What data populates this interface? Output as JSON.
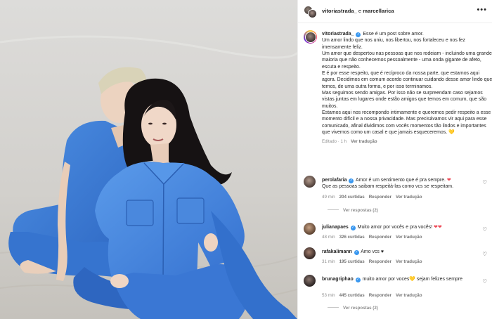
{
  "header": {
    "author": "vitoriastrada_",
    "connector": " e ",
    "coauthor": "marcellarica",
    "more_icon": "more-horizontal-icon"
  },
  "caption": {
    "username": "vitoriastrada_",
    "text": "Esse é um post sobre amor.\nUm amor lindo que nos uniu, nos libertou, nos fortaleceu e nos fez imensamente feliz.\nUm amor que despertou nas pessoas que nos rodeiam - incluindo uma grande maioria que não conhecemos pessoalmente - uma onda gigante de afeto, escuta e respeito.\nE é por esse respeito, que é recíproco da nossa parte, que estamos aqui agora. Decidimos em comum acordo continuar cuidando desse amor lindo que temos, de uma outra forma, e por isso terminamos.\nMas seguimos sendo amigas. Por isso não se surpreendam caso sejamos vistas juntas em lugares onde estão amigos que temos em comum, que são muitos.\nEstamos aqui nos recompondo intimamente e queremos pedir respeito a esse momento difícil e a nossa privacidade. Mas precisávamos vir aqui para esse comunicado, afinal dividimos com vocês momentos tão lindos e importantes que vivemos como um casal e que jamais esqueceremos. ",
    "emoji": "💛",
    "edited": "Editado · 1 h",
    "see_translation": "Ver tradução"
  },
  "comments": [
    {
      "username": "perolafaria",
      "verified": true,
      "text": "Amor é um sentimento que é pra sempre. ",
      "emoji": "❤",
      "text2": "Que as pessoas saibam respeitá-las como vcs se respeitam.",
      "time": "49 min",
      "likes": "204 curtidas",
      "reply": "Responder",
      "translate": "Ver tradução",
      "view_replies": "Ver respostas (2)"
    },
    {
      "username": "julianapaes",
      "verified": true,
      "text": "Muito amor por vocês e pra vocês! ",
      "emoji": "❤❤",
      "text2": "",
      "time": "48 min",
      "likes": "326 curtidas",
      "reply": "Responder",
      "translate": "Ver tradução",
      "view_replies": ""
    },
    {
      "username": "rafakalimann",
      "verified": true,
      "text": "Amo vcs ",
      "emoji": "♥",
      "text2": "",
      "time": "31 min",
      "likes": "195 curtidas",
      "reply": "Responder",
      "translate": "Ver tradução",
      "view_replies": ""
    },
    {
      "username": "brunagriphao",
      "verified": true,
      "text": "muito amor por voces",
      "emoji": "💛",
      "text2": " sejam felizes sempre",
      "time": "53 min",
      "likes": "445 curtidas",
      "reply": "Responder",
      "translate": "Ver tradução",
      "view_replies": "Ver respostas (2)"
    }
  ],
  "icons": {
    "like": "heart-outline-icon",
    "verified": "verified-badge-icon"
  },
  "colors": {
    "link_blue": "#3897f0",
    "muted": "#8e8e8e",
    "text": "#262626",
    "outfit_blue": "#3f7ed6"
  }
}
